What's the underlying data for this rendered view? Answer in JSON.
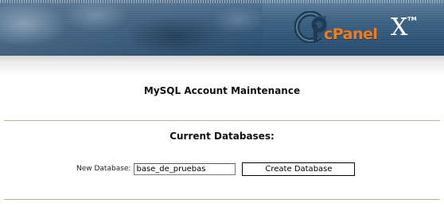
{
  "header": {
    "logo_text": "cPanel",
    "logo_version": "X",
    "logo_trademark": "TM",
    "brand_color": "#f07c1e",
    "logo_icon": "cpanel-logo-icon"
  },
  "main": {
    "title": "MySQL Account Maintenance",
    "section_title": "Current Databases:",
    "new_db_label": "New Database:",
    "new_db_value": "base_de_pruebas",
    "create_button_label": "Create Database"
  },
  "colors": {
    "divider": "#b9b79a",
    "header_dark": "#24496b"
  }
}
